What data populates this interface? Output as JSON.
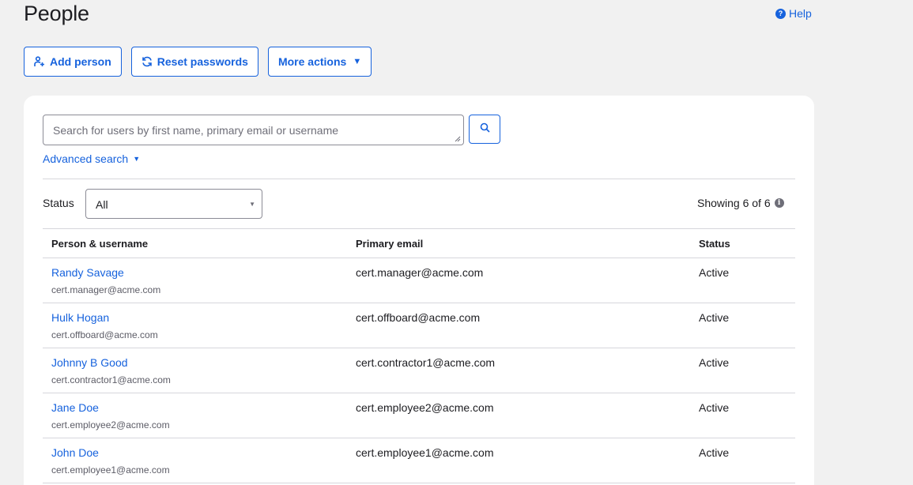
{
  "page": {
    "title": "People",
    "help_label": "Help"
  },
  "toolbar": {
    "add_person": "Add person",
    "reset_passwords": "Reset passwords",
    "more_actions": "More actions"
  },
  "search": {
    "placeholder": "Search for users by first name, primary email or username",
    "value": "",
    "advanced_label": "Advanced search"
  },
  "filter": {
    "status_label": "Status",
    "status_selected": "All",
    "showing": "Showing 6 of 6"
  },
  "table": {
    "headers": [
      "Person & username",
      "Primary email",
      "Status"
    ],
    "rows": [
      {
        "name": "Randy Savage",
        "username": "cert.manager@acme.com",
        "email": "cert.manager@acme.com",
        "status": "Active"
      },
      {
        "name": "Hulk Hogan",
        "username": "cert.offboard@acme.com",
        "email": "cert.offboard@acme.com",
        "status": "Active"
      },
      {
        "name": "Johnny B Good",
        "username": "cert.contractor1@acme.com",
        "email": "cert.contractor1@acme.com",
        "status": "Active"
      },
      {
        "name": "Jane Doe",
        "username": "cert.employee2@acme.com",
        "email": "cert.employee2@acme.com",
        "status": "Active"
      },
      {
        "name": "John Doe",
        "username": "cert.employee1@acme.com",
        "email": "cert.employee1@acme.com",
        "status": "Active"
      }
    ]
  },
  "colors": {
    "accent": "#1662dd",
    "background": "#f1f1f1",
    "card": "#ffffff"
  },
  "icons": [
    "help-icon",
    "add-person-icon",
    "refresh-icon",
    "caret-down-icon",
    "search-icon",
    "info-icon"
  ]
}
